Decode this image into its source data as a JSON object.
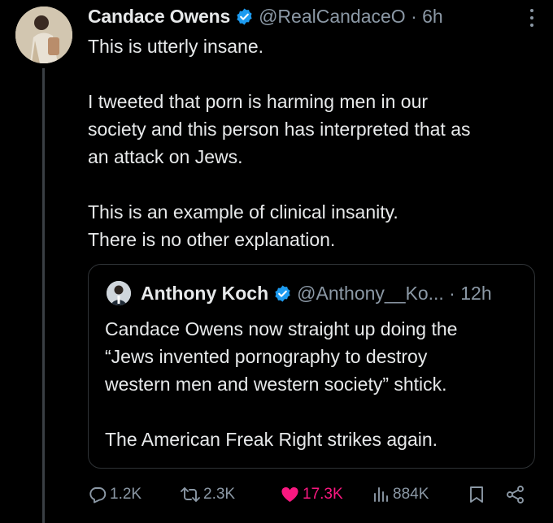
{
  "tweet": {
    "author_name": "Candace Owens",
    "handle": "@RealCandaceO",
    "time": "6h",
    "paragraphs": [
      "This is utterly insane.",
      "I tweeted that porn is harming men in our society and this person has interpreted that as an attack on Jews.",
      "This is an example of clinical insanity. There is no other explanation."
    ],
    "text_lines": [
      [
        "This is utterly insane."
      ],
      [
        "I tweeted that porn is harming men in our",
        "society and this person has interpreted that as",
        "an attack on Jews."
      ],
      [
        "This is an example of clinical insanity.",
        "There is no other explanation."
      ]
    ]
  },
  "quote": {
    "author_name": "Anthony Koch",
    "handle": "@Anthony__Ko...",
    "time": "12h",
    "text_lines": [
      [
        "Candace Owens now straight up doing the",
        "“Jews invented pornography to destroy",
        "western men and western society” shtick."
      ],
      [
        "The American Freak Right strikes again."
      ]
    ]
  },
  "actions": {
    "reply_count": "1.2K",
    "retweet_count": "2.3K",
    "like_count": "17.3K",
    "views_count": "884K"
  },
  "icons": {
    "verified": "verified-badge-icon",
    "more": "more-vertical-icon",
    "reply": "reply-icon",
    "retweet": "retweet-icon",
    "like": "heart-icon",
    "views": "views-icon",
    "bookmark": "bookmark-icon",
    "share": "share-icon"
  },
  "colors": {
    "background": "#000000",
    "text": "#e7e9ea",
    "secondary": "#8b98a5",
    "verified": "#1d9bf0",
    "like": "#f91880",
    "border": "#2f3336"
  }
}
